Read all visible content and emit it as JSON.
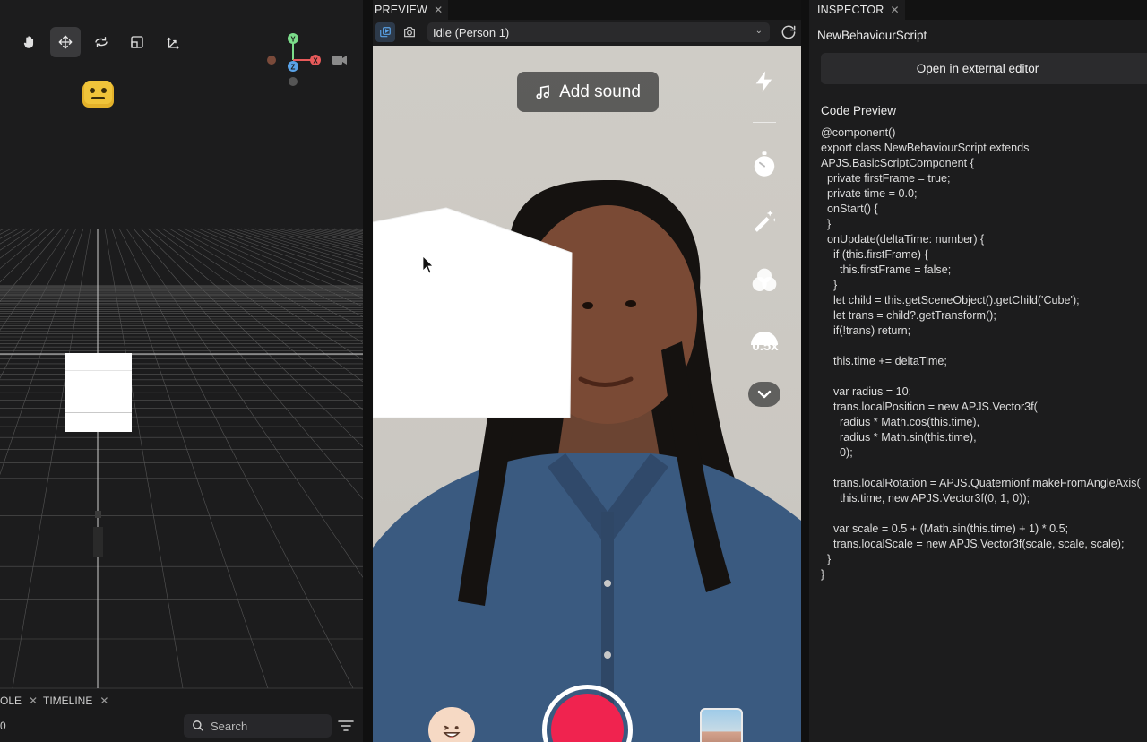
{
  "scene": {
    "tools": [
      "hand-icon",
      "move-icon",
      "rotate-icon",
      "scale-icon",
      "transform-icon"
    ],
    "gizmo": {
      "y_label": "Y",
      "x_label": "X",
      "z_label": "Z"
    },
    "bottom_tabs": [
      {
        "label": "OLE"
      },
      {
        "label": "TIMELINE"
      }
    ],
    "console_counter": "0",
    "search": {
      "placeholder": "Search"
    }
  },
  "preview": {
    "tab": {
      "label": "PREVIEW"
    },
    "subject": {
      "selected": "Idle (Person 1)"
    },
    "add_sound": {
      "label": "Add sound"
    },
    "side_tools": [
      "lightning-icon",
      "timer-icon",
      "magic-wand-icon",
      "filters-icon",
      "speed-icon",
      "chevron-down-icon"
    ],
    "speed": {
      "label": "0.5x"
    }
  },
  "inspector": {
    "tab": {
      "label": "INSPECTOR"
    },
    "script_name": "NewBehaviourScript",
    "open_editor_label": "Open in external editor",
    "code_heading": "Code Preview",
    "code": "@component()\nexport class NewBehaviourScript extends\nAPJS.BasicScriptComponent {\n  private firstFrame = true;\n  private time = 0.0;\n  onStart() {\n  }\n  onUpdate(deltaTime: number) {\n    if (this.firstFrame) {\n      this.firstFrame = false;\n    }\n    let child = this.getSceneObject().getChild('Cube');\n    let trans = child?.getTransform();\n    if(!trans) return;\n\n    this.time += deltaTime;\n\n    var radius = 10;\n    trans.localPosition = new APJS.Vector3f(\n      radius * Math.cos(this.time),\n      radius * Math.sin(this.time),\n      0);\n\n    trans.localRotation = APJS.Quaternionf.makeFromAngleAxis(\n      this.time, new APJS.Vector3f(0, 1, 0));\n\n    var scale = 0.5 + (Math.sin(this.time) + 1) * 0.5;\n    trans.localScale = new APJS.Vector3f(scale, scale, scale);\n  }\n}"
  },
  "colors": {
    "record": "#f0234f",
    "accent_tool": "#2d3a4a"
  }
}
